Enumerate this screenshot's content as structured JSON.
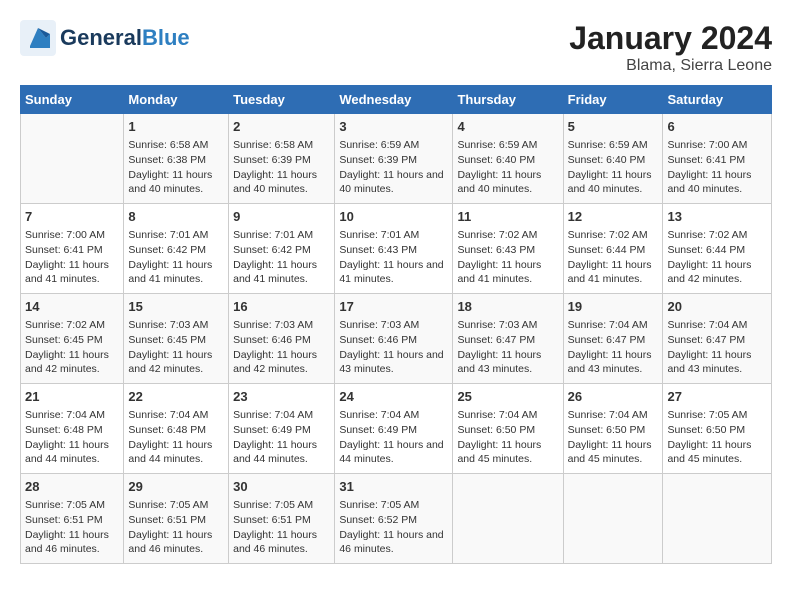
{
  "logo": {
    "general": "General",
    "blue": "Blue"
  },
  "title": "January 2024",
  "subtitle": "Blama, Sierra Leone",
  "headers": [
    "Sunday",
    "Monday",
    "Tuesday",
    "Wednesday",
    "Thursday",
    "Friday",
    "Saturday"
  ],
  "weeks": [
    [
      {
        "day": "",
        "sunrise": "",
        "sunset": "",
        "daylight": ""
      },
      {
        "day": "1",
        "sunrise": "Sunrise: 6:58 AM",
        "sunset": "Sunset: 6:38 PM",
        "daylight": "Daylight: 11 hours and 40 minutes."
      },
      {
        "day": "2",
        "sunrise": "Sunrise: 6:58 AM",
        "sunset": "Sunset: 6:39 PM",
        "daylight": "Daylight: 11 hours and 40 minutes."
      },
      {
        "day": "3",
        "sunrise": "Sunrise: 6:59 AM",
        "sunset": "Sunset: 6:39 PM",
        "daylight": "Daylight: 11 hours and 40 minutes."
      },
      {
        "day": "4",
        "sunrise": "Sunrise: 6:59 AM",
        "sunset": "Sunset: 6:40 PM",
        "daylight": "Daylight: 11 hours and 40 minutes."
      },
      {
        "day": "5",
        "sunrise": "Sunrise: 6:59 AM",
        "sunset": "Sunset: 6:40 PM",
        "daylight": "Daylight: 11 hours and 40 minutes."
      },
      {
        "day": "6",
        "sunrise": "Sunrise: 7:00 AM",
        "sunset": "Sunset: 6:41 PM",
        "daylight": "Daylight: 11 hours and 40 minutes."
      }
    ],
    [
      {
        "day": "7",
        "sunrise": "Sunrise: 7:00 AM",
        "sunset": "Sunset: 6:41 PM",
        "daylight": "Daylight: 11 hours and 41 minutes."
      },
      {
        "day": "8",
        "sunrise": "Sunrise: 7:01 AM",
        "sunset": "Sunset: 6:42 PM",
        "daylight": "Daylight: 11 hours and 41 minutes."
      },
      {
        "day": "9",
        "sunrise": "Sunrise: 7:01 AM",
        "sunset": "Sunset: 6:42 PM",
        "daylight": "Daylight: 11 hours and 41 minutes."
      },
      {
        "day": "10",
        "sunrise": "Sunrise: 7:01 AM",
        "sunset": "Sunset: 6:43 PM",
        "daylight": "Daylight: 11 hours and 41 minutes."
      },
      {
        "day": "11",
        "sunrise": "Sunrise: 7:02 AM",
        "sunset": "Sunset: 6:43 PM",
        "daylight": "Daylight: 11 hours and 41 minutes."
      },
      {
        "day": "12",
        "sunrise": "Sunrise: 7:02 AM",
        "sunset": "Sunset: 6:44 PM",
        "daylight": "Daylight: 11 hours and 41 minutes."
      },
      {
        "day": "13",
        "sunrise": "Sunrise: 7:02 AM",
        "sunset": "Sunset: 6:44 PM",
        "daylight": "Daylight: 11 hours and 42 minutes."
      }
    ],
    [
      {
        "day": "14",
        "sunrise": "Sunrise: 7:02 AM",
        "sunset": "Sunset: 6:45 PM",
        "daylight": "Daylight: 11 hours and 42 minutes."
      },
      {
        "day": "15",
        "sunrise": "Sunrise: 7:03 AM",
        "sunset": "Sunset: 6:45 PM",
        "daylight": "Daylight: 11 hours and 42 minutes."
      },
      {
        "day": "16",
        "sunrise": "Sunrise: 7:03 AM",
        "sunset": "Sunset: 6:46 PM",
        "daylight": "Daylight: 11 hours and 42 minutes."
      },
      {
        "day": "17",
        "sunrise": "Sunrise: 7:03 AM",
        "sunset": "Sunset: 6:46 PM",
        "daylight": "Daylight: 11 hours and 43 minutes."
      },
      {
        "day": "18",
        "sunrise": "Sunrise: 7:03 AM",
        "sunset": "Sunset: 6:47 PM",
        "daylight": "Daylight: 11 hours and 43 minutes."
      },
      {
        "day": "19",
        "sunrise": "Sunrise: 7:04 AM",
        "sunset": "Sunset: 6:47 PM",
        "daylight": "Daylight: 11 hours and 43 minutes."
      },
      {
        "day": "20",
        "sunrise": "Sunrise: 7:04 AM",
        "sunset": "Sunset: 6:47 PM",
        "daylight": "Daylight: 11 hours and 43 minutes."
      }
    ],
    [
      {
        "day": "21",
        "sunrise": "Sunrise: 7:04 AM",
        "sunset": "Sunset: 6:48 PM",
        "daylight": "Daylight: 11 hours and 44 minutes."
      },
      {
        "day": "22",
        "sunrise": "Sunrise: 7:04 AM",
        "sunset": "Sunset: 6:48 PM",
        "daylight": "Daylight: 11 hours and 44 minutes."
      },
      {
        "day": "23",
        "sunrise": "Sunrise: 7:04 AM",
        "sunset": "Sunset: 6:49 PM",
        "daylight": "Daylight: 11 hours and 44 minutes."
      },
      {
        "day": "24",
        "sunrise": "Sunrise: 7:04 AM",
        "sunset": "Sunset: 6:49 PM",
        "daylight": "Daylight: 11 hours and 44 minutes."
      },
      {
        "day": "25",
        "sunrise": "Sunrise: 7:04 AM",
        "sunset": "Sunset: 6:50 PM",
        "daylight": "Daylight: 11 hours and 45 minutes."
      },
      {
        "day": "26",
        "sunrise": "Sunrise: 7:04 AM",
        "sunset": "Sunset: 6:50 PM",
        "daylight": "Daylight: 11 hours and 45 minutes."
      },
      {
        "day": "27",
        "sunrise": "Sunrise: 7:05 AM",
        "sunset": "Sunset: 6:50 PM",
        "daylight": "Daylight: 11 hours and 45 minutes."
      }
    ],
    [
      {
        "day": "28",
        "sunrise": "Sunrise: 7:05 AM",
        "sunset": "Sunset: 6:51 PM",
        "daylight": "Daylight: 11 hours and 46 minutes."
      },
      {
        "day": "29",
        "sunrise": "Sunrise: 7:05 AM",
        "sunset": "Sunset: 6:51 PM",
        "daylight": "Daylight: 11 hours and 46 minutes."
      },
      {
        "day": "30",
        "sunrise": "Sunrise: 7:05 AM",
        "sunset": "Sunset: 6:51 PM",
        "daylight": "Daylight: 11 hours and 46 minutes."
      },
      {
        "day": "31",
        "sunrise": "Sunrise: 7:05 AM",
        "sunset": "Sunset: 6:52 PM",
        "daylight": "Daylight: 11 hours and 46 minutes."
      },
      {
        "day": "",
        "sunrise": "",
        "sunset": "",
        "daylight": ""
      },
      {
        "day": "",
        "sunrise": "",
        "sunset": "",
        "daylight": ""
      },
      {
        "day": "",
        "sunrise": "",
        "sunset": "",
        "daylight": ""
      }
    ]
  ]
}
